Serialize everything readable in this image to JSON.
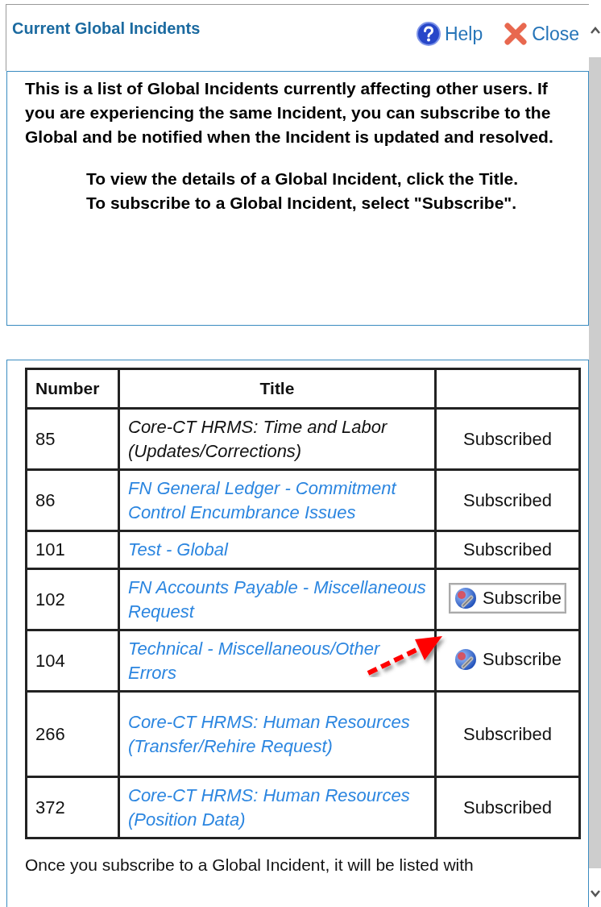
{
  "window": {
    "title": "Current Global Incidents",
    "actions": [
      {
        "kind": "help",
        "label": "Help"
      },
      {
        "kind": "close",
        "label": "Close"
      }
    ]
  },
  "intro": {
    "paragraph": "This is a list of Global Incidents currently affecting other users. If you are experiencing the same Incident, you can subscribe to the Global and be notified when the Incident is updated and resolved.",
    "instructions": [
      "To view the details of a Global Incident, click the Title.",
      "To subscribe to a Global Incident, select \"Subscribe\"."
    ]
  },
  "table": {
    "columns": [
      "Number",
      "Title"
    ],
    "rows": [
      {
        "number": "85",
        "title": "Core-CT HRMS: Time and Labor (Updates/Corrections)",
        "link": false,
        "action": {
          "kind": "status",
          "label": "Subscribed"
        }
      },
      {
        "number": "86",
        "title": "FN General Ledger - Commitment Control Encumbrance Issues",
        "link": true,
        "action": {
          "kind": "status",
          "label": "Subscribed"
        }
      },
      {
        "number": "101",
        "title": "Test - Global",
        "link": true,
        "action": {
          "kind": "status",
          "label": "Subscribed"
        }
      },
      {
        "number": "102",
        "title": "FN Accounts Payable - Miscellaneous Request",
        "link": true,
        "action": {
          "kind": "button",
          "label": "Subscribe",
          "outlined": true
        }
      },
      {
        "number": "104",
        "title": "Technical - Miscellaneous/Other Errors",
        "link": true,
        "action": {
          "kind": "button",
          "label": "Subscribe",
          "outlined": false
        }
      },
      {
        "number": "266",
        "title": "Core-CT HRMS: Human Resources (Transfer/Rehire Request)",
        "link": true,
        "action": {
          "kind": "status",
          "label": "Subscribed"
        }
      },
      {
        "number": "372",
        "title": "Core-CT HRMS: Human Resources (Position Data)",
        "link": true,
        "action": {
          "kind": "status",
          "label": "Subscribed"
        }
      }
    ]
  },
  "footer": "Once you subscribe to a Global Incident, it will be listed with"
}
